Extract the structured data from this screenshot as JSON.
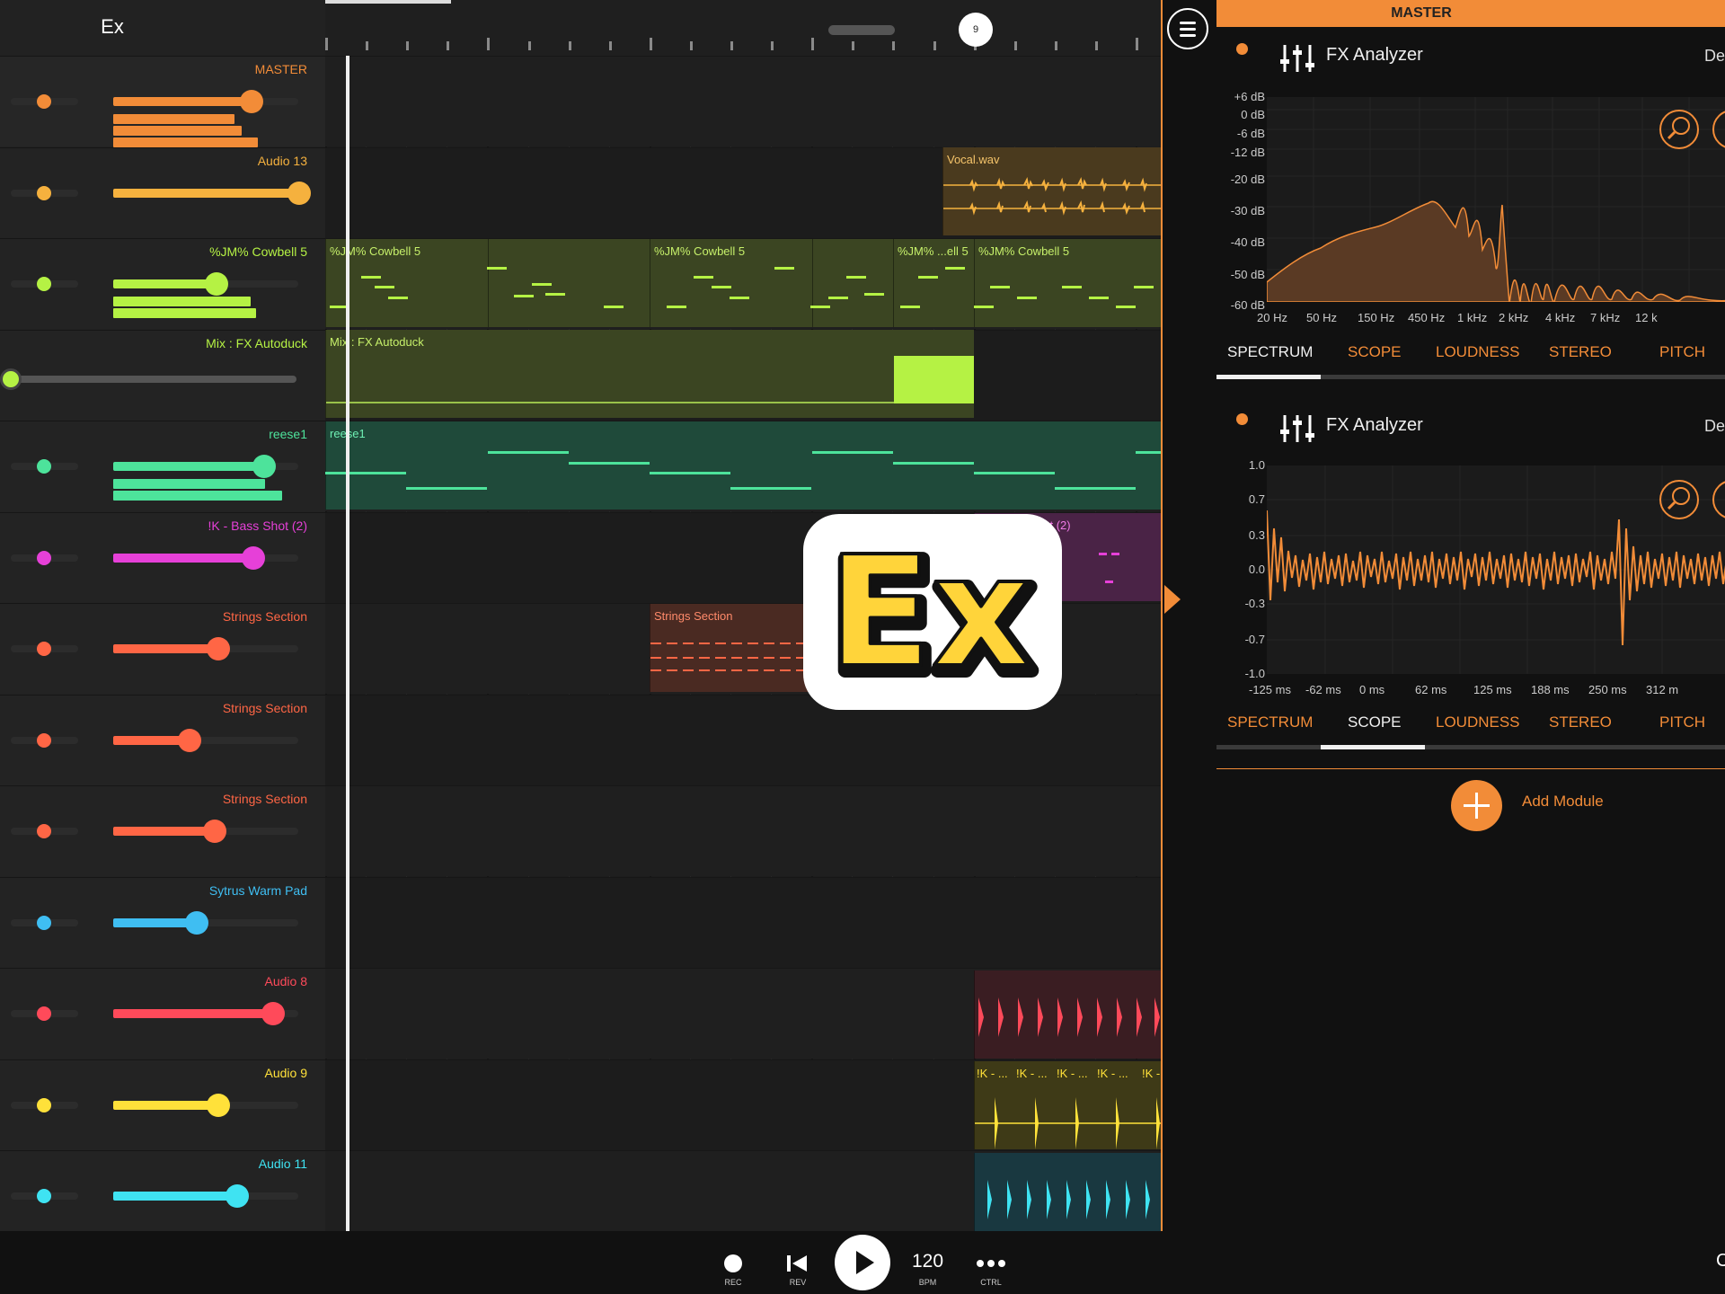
{
  "app": {
    "title": "Ex"
  },
  "tracks": [
    {
      "name": "MASTER",
      "color": "#f28c38",
      "level": 0.74,
      "meters": [
        0.66,
        0.7,
        0.79
      ]
    },
    {
      "name": "Audio 13",
      "color": "#f5b13e",
      "level": 1.0,
      "meters": []
    },
    {
      "name": "%JM% Cowbell 5",
      "color": "#b5f244",
      "level": 0.55,
      "meters": [
        0.75,
        0.78
      ]
    },
    {
      "name": "Mix : FX Autoduck",
      "color": "#b5f244",
      "level": 0.0,
      "meters": []
    },
    {
      "name": "reese1",
      "color": "#4de39b",
      "level": 0.81,
      "meters": [
        0.83,
        0.92
      ]
    },
    {
      "name": "!K - Bass Shot (2)",
      "color": "#e640d8",
      "level": 0.75,
      "meters": []
    },
    {
      "name": "Strings Section",
      "color": "#ff6645",
      "level": 0.56,
      "meters": []
    },
    {
      "name": "Strings Section",
      "color": "#ff6645",
      "level": 0.4,
      "meters": []
    },
    {
      "name": "Strings Section",
      "color": "#ff6645",
      "level": 0.54,
      "meters": []
    },
    {
      "name": "Sytrus Warm Pad",
      "color": "#3fbef2",
      "level": 0.44,
      "meters": []
    },
    {
      "name": "Audio 8",
      "color": "#ff4a5a",
      "level": 0.86,
      "meters": []
    },
    {
      "name": "Audio 9",
      "color": "#ffe13a",
      "level": 0.56,
      "meters": []
    },
    {
      "name": "Audio 11",
      "color": "#3fe3f2",
      "level": 0.66,
      "meters": []
    }
  ],
  "arrangement": {
    "ruler_marker": "9",
    "clips": {
      "vocal": "Vocal.wav",
      "cowbell_1": "%JM% Cowbell 5",
      "cowbell_2": "%JM% Cowbell 5",
      "cowbell_3": "%JM% ...ell 5",
      "cowbell_4": "%JM% Cowbell 5",
      "autoduck": "Mix : FX Autoduck",
      "reese": "reese1",
      "bass_shot": "!K - Bass Shot (2)",
      "strings": "Strings Section",
      "audio9_a": "!K - ...",
      "audio9_b": "!K - ...",
      "audio9_c": "!K - ...",
      "audio9_d": "!K - ...",
      "audio9_e": "!K -"
    }
  },
  "overlay_badge": "Ex",
  "fx_panel": {
    "header": "MASTER",
    "accent": "#f28c38",
    "modules": [
      {
        "title": "FX Analyzer",
        "preset": "De",
        "active_tab": "SPECTRUM",
        "y_labels": [
          "+6 dB",
          "0 dB",
          "-6 dB",
          "-12 dB",
          "-20 dB",
          "-30 dB",
          "-40 dB",
          "-50 dB",
          "-60 dB"
        ],
        "x_labels": [
          "20 Hz",
          "50 Hz",
          "150 Hz",
          "450 Hz",
          "1 kHz",
          "2 kHz",
          "4 kHz",
          "7 kHz",
          "12 k"
        ],
        "tabs": [
          "SPECTRUM",
          "SCOPE",
          "LOUDNESS",
          "STEREO",
          "PITCH"
        ]
      },
      {
        "title": "FX Analyzer",
        "preset": "De",
        "active_tab": "SCOPE",
        "y_labels": [
          "1.0",
          "0.7",
          "0.3",
          "0.0",
          "-0.3",
          "-0.7",
          "-1.0"
        ],
        "x_labels": [
          "-125 ms",
          "-62 ms",
          "0 ms",
          "62 ms",
          "125 ms",
          "188 ms",
          "250 ms",
          "312 m"
        ],
        "tabs": [
          "SPECTRUM",
          "SCOPE",
          "LOUDNESS",
          "STEREO",
          "PITCH"
        ]
      }
    ],
    "add_module": "Add Module"
  },
  "transport": {
    "rec": "REC",
    "rev": "REV",
    "bpm_value": "120",
    "bpm_label": "BPM",
    "ctrl": "CTRL",
    "right_edge": "C"
  }
}
